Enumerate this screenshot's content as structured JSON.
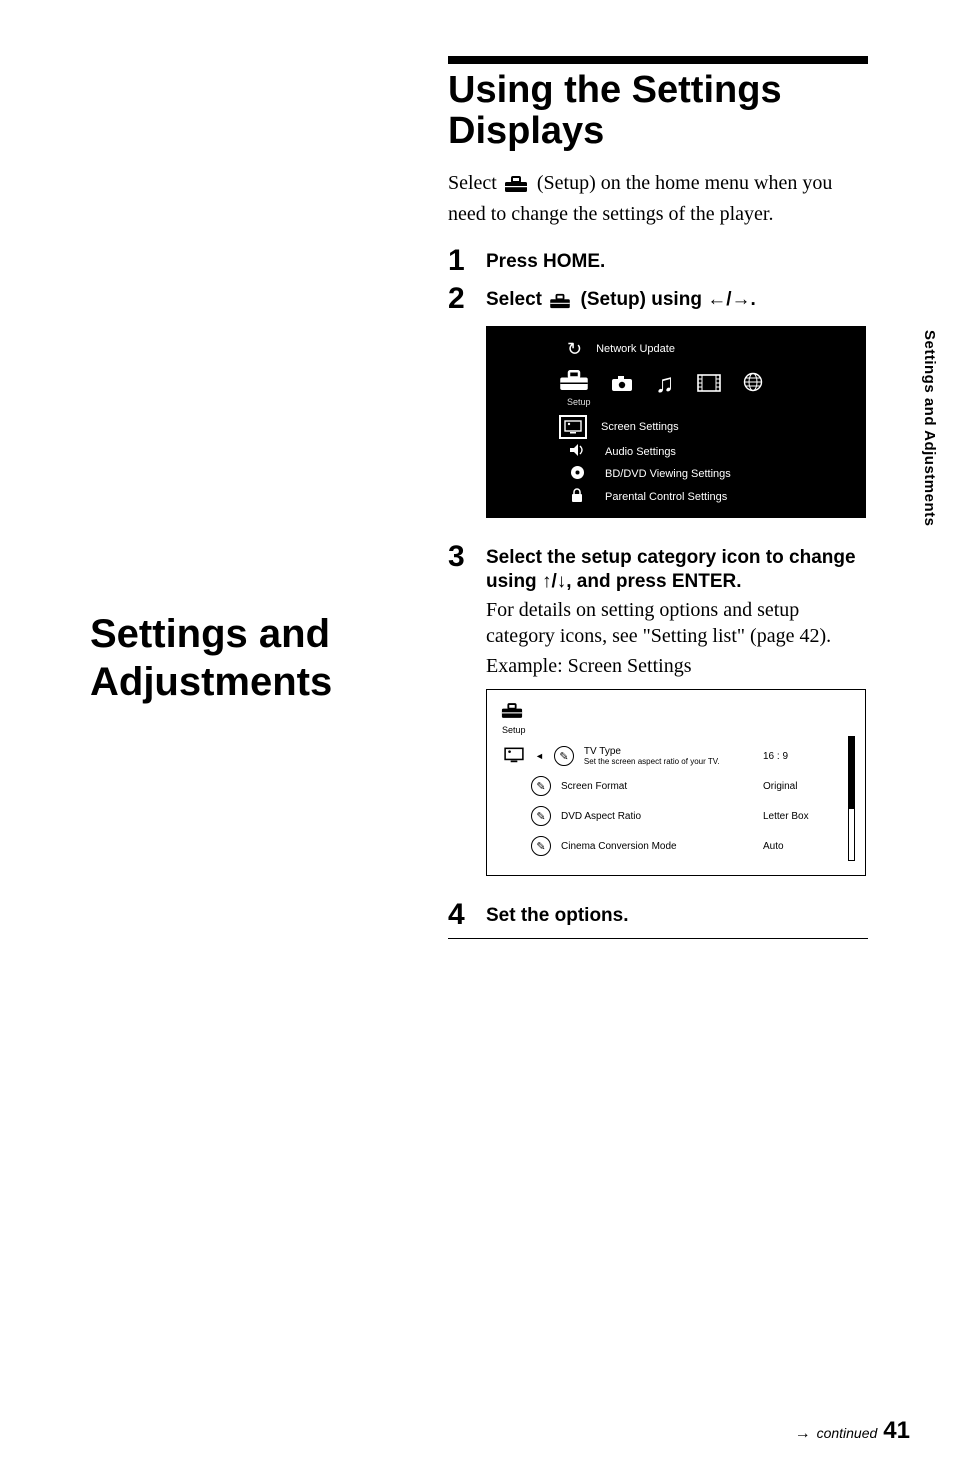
{
  "side_tab": "Settings and Adjustments",
  "left_title": "Settings and Adjustments",
  "main_heading": "Using the Settings Displays",
  "intro_before_icon": "Select ",
  "intro_after_icon": " (Setup) on the home menu when you need to change the settings of the player.",
  "steps": {
    "s1": {
      "num": "1",
      "head": "Press HOME."
    },
    "s2": {
      "num": "2",
      "head_before": "Select ",
      "head_mid": " (Setup) using ",
      "head_arrows": "←/→",
      "head_end": "."
    },
    "s3": {
      "num": "3",
      "head_l1": "Select the setup category icon to ",
      "head_l2a": "change using ",
      "head_arrows": "↑/↓",
      "head_l2b": ", and press ENTER.",
      "body1": "For details on setting options and setup category icons, see \"Setting list\" (page 42).",
      "body2": "Example: Screen Settings"
    },
    "s4": {
      "num": "4",
      "head": "Set the options."
    }
  },
  "screenshot1": {
    "top_item": "Network Update",
    "setup_label": "Setup",
    "selected": "Screen Settings",
    "items": [
      "Audio Settings",
      "BD/DVD Viewing Settings",
      "Parental Control Settings"
    ]
  },
  "screenshot2": {
    "setup_label": "Setup",
    "rows": [
      {
        "label": "TV Type",
        "sub": "Set the screen aspect ratio of your TV.",
        "value": "16 : 9"
      },
      {
        "label": "Screen Format",
        "value": "Original"
      },
      {
        "label": "DVD Aspect Ratio",
        "value": "Letter Box"
      },
      {
        "label": "Cinema Conversion Mode",
        "value": "Auto"
      }
    ]
  },
  "footer": {
    "arrow": "→",
    "continued": "continued",
    "page": "41"
  }
}
